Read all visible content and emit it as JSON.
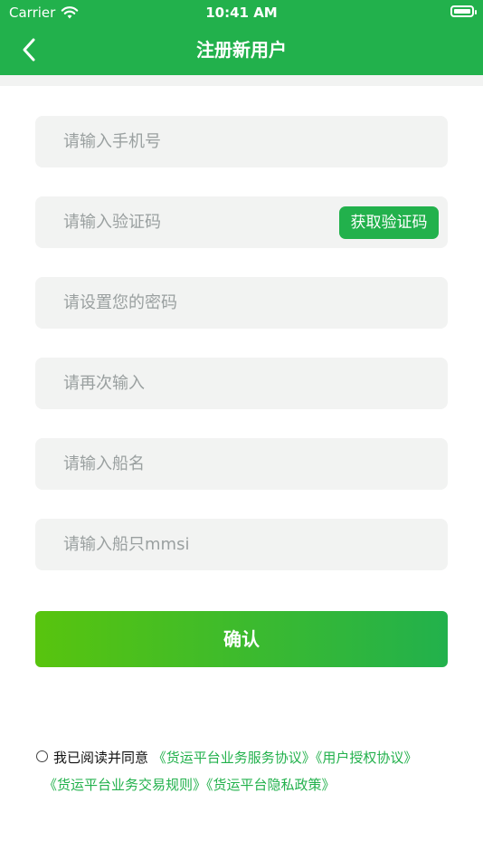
{
  "status_bar": {
    "carrier": "Carrier",
    "time": "10:41 AM",
    "wifi_icon": "wifi-icon",
    "battery_icon": "battery-icon"
  },
  "nav": {
    "title": "注册新用户",
    "back_icon": "chevron-left-icon"
  },
  "form": {
    "phone_placeholder": "请输入手机号",
    "code_placeholder": "请输入验证码",
    "get_code_label": "获取验证码",
    "password_placeholder": "请设置您的密码",
    "password_confirm_placeholder": "请再次输入",
    "ship_name_placeholder": "请输入船名",
    "mmsi_placeholder": "请输入船只mmsi"
  },
  "confirm_label": "确认",
  "agreement": {
    "prefix": "我已阅读并同意",
    "links": [
      "《货运平台业务服务协议》",
      "《用户授权协议》",
      "《货运平台业务交易规则》",
      "《货运平台隐私政策》"
    ]
  },
  "colors": {
    "brand": "#22b14c",
    "field_bg": "#f2f3f2",
    "placeholder": "#9aa0a0"
  }
}
